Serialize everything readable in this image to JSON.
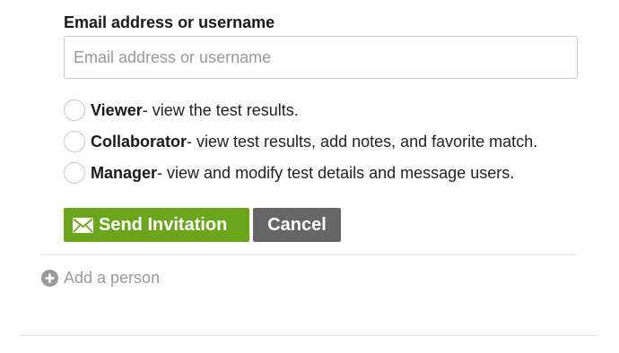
{
  "form": {
    "email_label": "Email address or username",
    "email_placeholder": "Email address or username",
    "email_value": ""
  },
  "roles": [
    {
      "name": "Viewer",
      "description": " - view the test results."
    },
    {
      "name": "Collaborator",
      "description": " - view test results, add notes, and favorite match."
    },
    {
      "name": "Manager",
      "description": " - view and modify test details and message users."
    }
  ],
  "buttons": {
    "send_label": "Send Invitation",
    "cancel_label": "Cancel"
  },
  "add_person_label": "Add a person",
  "colors": {
    "send_button": "#6aa51b",
    "cancel_button": "#666666",
    "muted_text": "#9a9a9a"
  },
  "icons": {
    "send": "envelope-icon",
    "add": "plus-circle-icon"
  }
}
